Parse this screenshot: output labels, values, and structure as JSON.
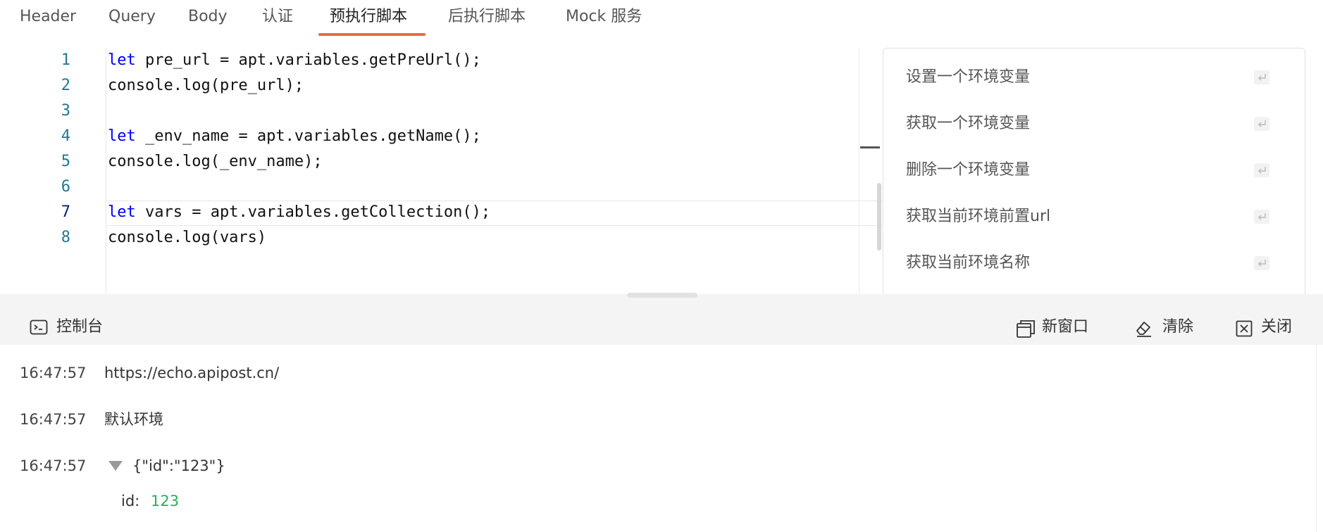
{
  "tabs": [
    {
      "label": "Header"
    },
    {
      "label": "Query"
    },
    {
      "label": "Body"
    },
    {
      "label": "认证"
    },
    {
      "label": "预执行脚本",
      "active": true
    },
    {
      "label": "后执行脚本"
    },
    {
      "label": "Mock 服务"
    }
  ],
  "editor": {
    "current_line": 7,
    "lines": [
      {
        "num": "1",
        "kw": "let",
        "rest": " pre_url = apt.variables.getPreUrl();"
      },
      {
        "num": "2",
        "kw": "",
        "rest": "console.log(pre_url);"
      },
      {
        "num": "3",
        "kw": "",
        "rest": ""
      },
      {
        "num": "4",
        "kw": "let",
        "rest": " _env_name = apt.variables.getName();"
      },
      {
        "num": "5",
        "kw": "",
        "rest": "console.log(_env_name);"
      },
      {
        "num": "6",
        "kw": "",
        "rest": ""
      },
      {
        "num": "7",
        "kw": "let",
        "rest": " vars = apt.variables.getCollection();"
      },
      {
        "num": "8",
        "kw": "",
        "rest": "console.log(vars)"
      }
    ]
  },
  "suggestions": [
    {
      "label": "设置一个环境变量"
    },
    {
      "label": "获取一个环境变量"
    },
    {
      "label": "删除一个环境变量"
    },
    {
      "label": "获取当前环境前置url"
    },
    {
      "label": "获取当前环境名称"
    }
  ],
  "console": {
    "title": "控制台",
    "buttons": {
      "new_window": "新窗口",
      "clear": "清除",
      "close": "关闭"
    },
    "logs": [
      {
        "time": "16:47:57",
        "message": "https://echo.apipost.cn/"
      },
      {
        "time": "16:47:57",
        "message": "默认环境"
      },
      {
        "time": "16:47:57",
        "object": "{\"id\":\"123\"}",
        "entries": [
          {
            "key": "id:",
            "value": "123"
          }
        ]
      }
    ]
  },
  "colors": {
    "accent": "#ee6a3d",
    "keyword": "#0000ff",
    "line_number": "#237893",
    "value_green": "#21b35b"
  }
}
